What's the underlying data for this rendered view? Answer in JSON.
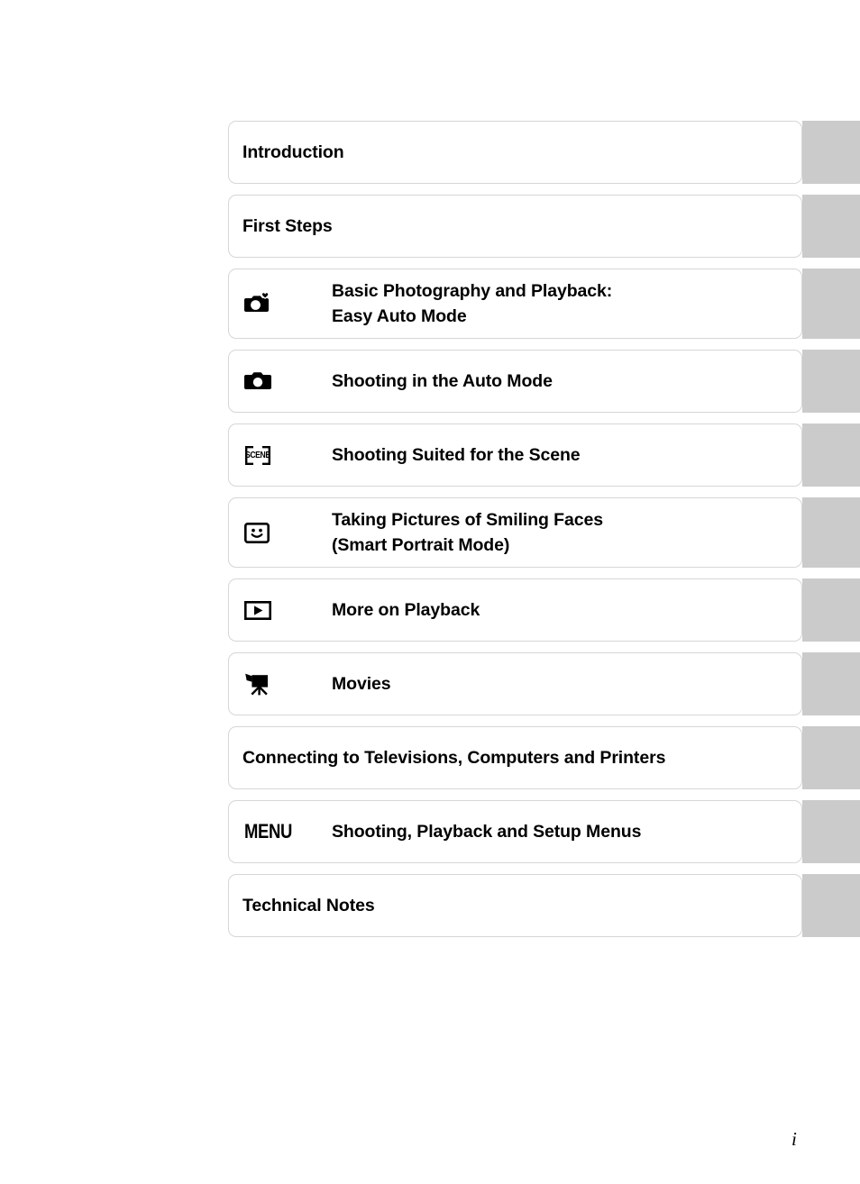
{
  "page": {
    "folio": "i",
    "tab_color": "#cbcbcb",
    "box_border_color": "#d6d6d6",
    "text_color": "#000000",
    "background": "#ffffff"
  },
  "contents": {
    "rows": [
      {
        "icon": null,
        "title_line1": "Introduction",
        "title_line2": "",
        "has_icon": false
      },
      {
        "icon": null,
        "title_line1": "First Steps",
        "title_line2": "",
        "has_icon": false
      },
      {
        "icon": "easy-auto-camera-heart-icon",
        "title_line1": "Basic Photography and Playback:",
        "title_line2": "Easy Auto Mode",
        "has_icon": true
      },
      {
        "icon": "camera-icon",
        "title_line1": "Shooting in the Auto Mode",
        "title_line2": "",
        "has_icon": true
      },
      {
        "icon": "scene-icon",
        "icon_label": "SCENE",
        "title_line1": "Shooting Suited for the Scene",
        "title_line2": "",
        "has_icon": true
      },
      {
        "icon": "smile-face-icon",
        "title_line1": "Taking Pictures of Smiling Faces",
        "title_line2": "(Smart Portrait Mode)",
        "has_icon": true
      },
      {
        "icon": "playback-triangle-icon",
        "title_line1": "More on Playback",
        "title_line2": "",
        "has_icon": true
      },
      {
        "icon": "movie-camera-icon",
        "title_line1": "Movies",
        "title_line2": "",
        "has_icon": true
      },
      {
        "icon": null,
        "title_line1": "Connecting to Televisions, Computers and Printers",
        "title_line2": "",
        "has_icon": false
      },
      {
        "icon": "menu-wordmark-icon",
        "icon_label": "MENU",
        "title_line1": "Shooting, Playback and Setup Menus",
        "title_line2": "",
        "has_icon": true
      },
      {
        "icon": null,
        "title_line1": "Technical Notes",
        "title_line2": "",
        "has_icon": false
      }
    ]
  }
}
